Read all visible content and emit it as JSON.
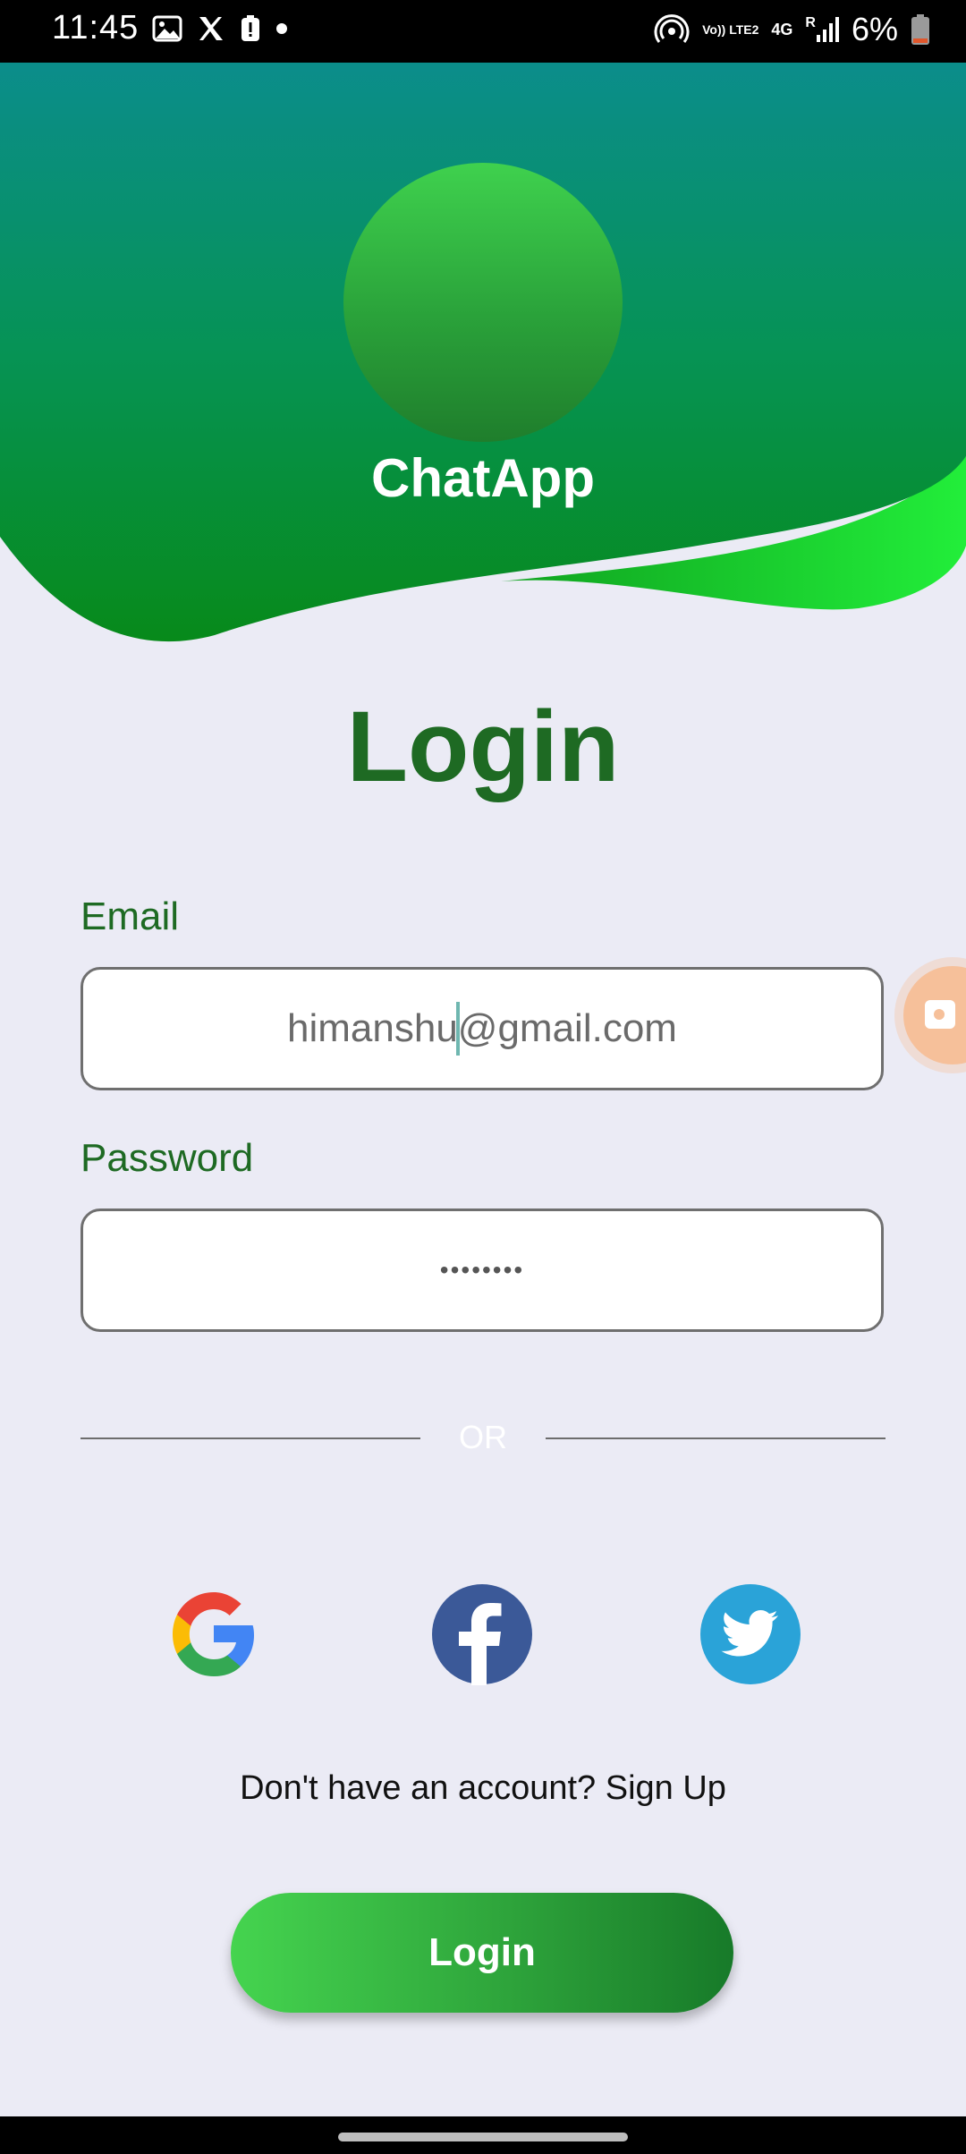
{
  "status_bar": {
    "time": "11:45",
    "battery_percent": "6%",
    "network_labels": [
      "Vo)) LTE2",
      "4G",
      "R"
    ],
    "icons_left": [
      "gallery-icon",
      "x-icon",
      "alert-icon",
      "dot-icon"
    ],
    "icons_right": [
      "hotspot-icon",
      "volte-icon",
      "4g-icon",
      "signal-icon",
      "battery-icon"
    ]
  },
  "header": {
    "app_name": "ChatApp"
  },
  "page": {
    "title": "Login"
  },
  "form": {
    "email": {
      "label": "Email",
      "value_before_caret": "himanshu",
      "value_after_caret": "@gmail.com"
    },
    "password": {
      "label": "Password",
      "masked_value": "••••••••"
    }
  },
  "divider": {
    "text": "OR"
  },
  "social_login": [
    "google-icon",
    "facebook-icon",
    "twitter-icon"
  ],
  "signup_prompt": "Don't have an account? Sign Up",
  "login_button": "Login",
  "colors": {
    "primary_green": "#1e6a23",
    "header_teal": "#0d8c86",
    "header_green": "#0a8a1e",
    "accent_green": "#1fe03a",
    "background": "#ebebf5",
    "float_button": "#f6c09a"
  }
}
